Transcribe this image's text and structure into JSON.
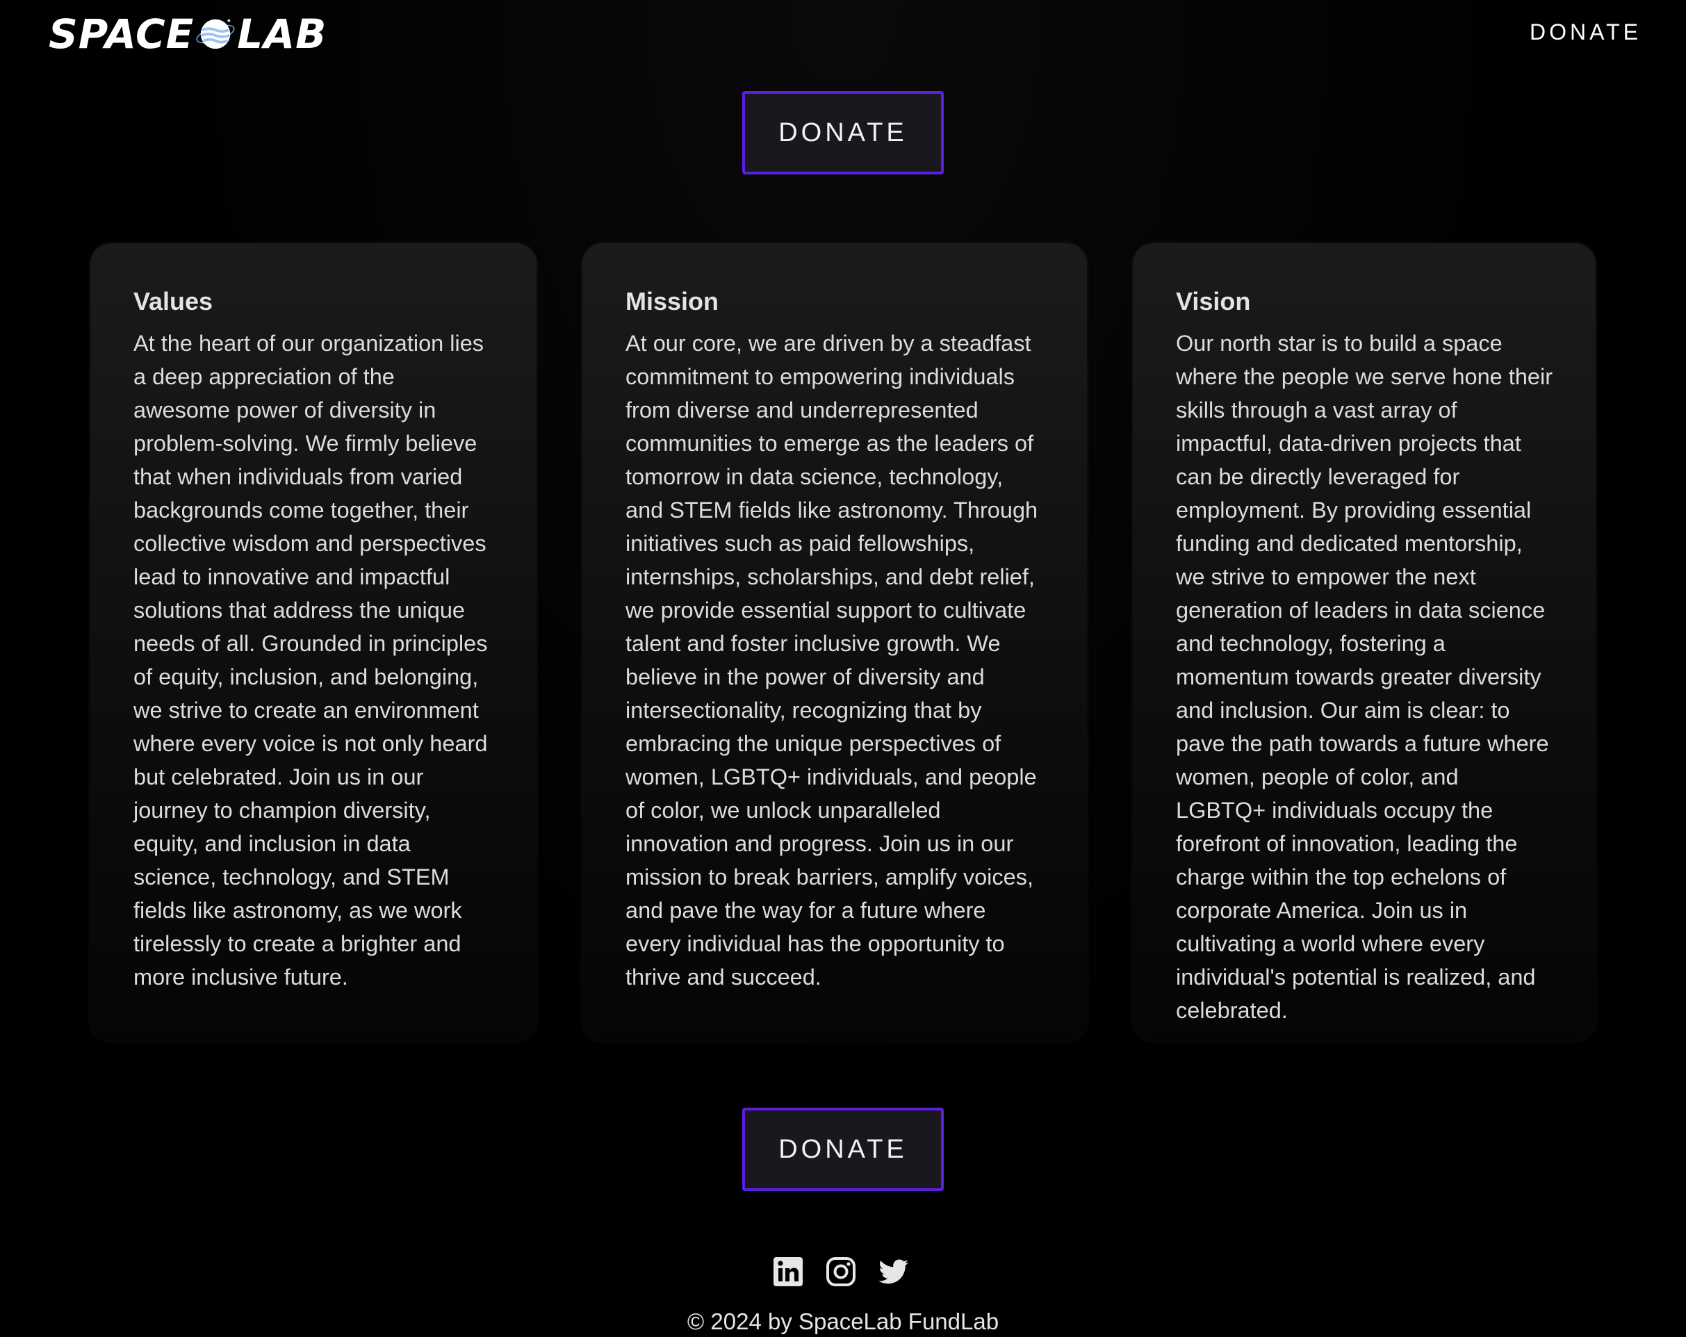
{
  "header": {
    "logo_text_left": "SPACE",
    "logo_text_right": "LAB",
    "nav_donate_label": "DONATE"
  },
  "buttons": {
    "donate_top_label": "DONATE",
    "donate_bottom_label": "DONATE"
  },
  "cards": [
    {
      "title": "Values",
      "body": "At the heart of our organization lies a deep appreciation of the awesome power of diversity in problem-solving. We firmly believe that when individuals from varied backgrounds come together, their collective wisdom and perspectives lead to innovative and impactful solutions that address the unique needs of all. Grounded in principles of equity, inclusion, and belonging, we strive to create an environment where every voice is not only heard but celebrated. Join us in our journey to champion diversity, equity, and inclusion in data science, technology, and STEM fields like astronomy, as we work tirelessly to create a brighter and more inclusive future."
    },
    {
      "title": "Mission",
      "body": "At our core, we are driven by a steadfast commitment to empowering individuals from diverse and underrepresented communities to emerge as the leaders of tomorrow in data science, technology, and STEM fields like astronomy. Through initiatives such as paid fellowships, internships, scholarships, and debt relief, we provide essential support to cultivate talent and foster inclusive growth. We believe in the power of diversity and intersectionality, recognizing that by embracing the unique perspectives of women, LGBTQ+ individuals, and people of color, we unlock unparalleled innovation and progress. Join us in our mission to break barriers, amplify voices, and pave the way for a future where every individual has the opportunity to thrive and succeed."
    },
    {
      "title": "Vision",
      "body": "Our north star is to build a space where the people we serve hone their skills through a vast array of impactful, data-driven projects that can be directly leveraged for employment. By providing essential funding and dedicated mentorship, we strive to empower the next generation of leaders in data science and technology, fostering a momentum towards greater diversity and inclusion. Our aim is clear: to pave the path towards a future where women, people of color, and LGBTQ+ individuals occupy the forefront of innovation, leading the charge within the top echelons of corporate America. Join us in cultivating a world where every individual's potential is realized, and celebrated."
    }
  ],
  "footer": {
    "social_icons": [
      "linkedin-icon",
      "instagram-icon",
      "twitter-icon"
    ],
    "copyright": "© 2024 by SpaceLab FundLab"
  },
  "colors": {
    "background": "#000000",
    "button_border": "#5a1fe0",
    "button_fill": "#18181e",
    "card_top": "#1b1b1d",
    "text": "#dcdcde"
  }
}
